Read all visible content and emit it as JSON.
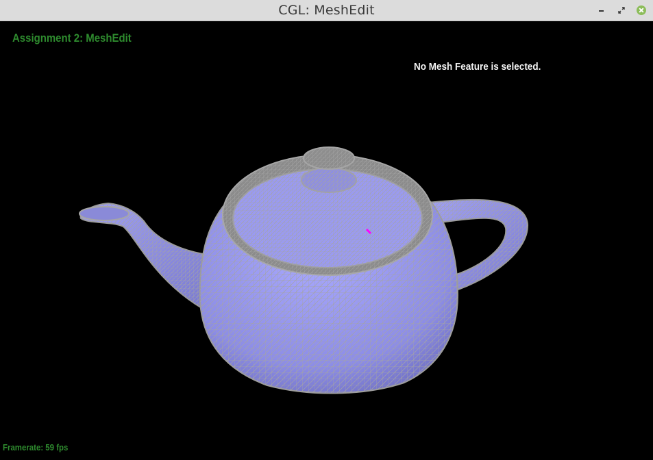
{
  "window": {
    "title": "CGL: MeshEdit"
  },
  "overlay": {
    "assignment_title": "Assignment 2: MeshEdit",
    "selection_status": "No Mesh Feature is selected.",
    "framerate": "Framerate: 59 fps"
  },
  "scene": {
    "model": "teapot",
    "render_mode": "wireframe-over-shaded",
    "colors": {
      "background": "#000000",
      "surface": "#9b9bf0",
      "surface_shadow": "#7070c8",
      "wireframe": "#a0a0a0",
      "cursor_marker": "#ff00ff",
      "overlay_text": "#2e8b2e",
      "status_text": "#f4f4f4"
    }
  }
}
